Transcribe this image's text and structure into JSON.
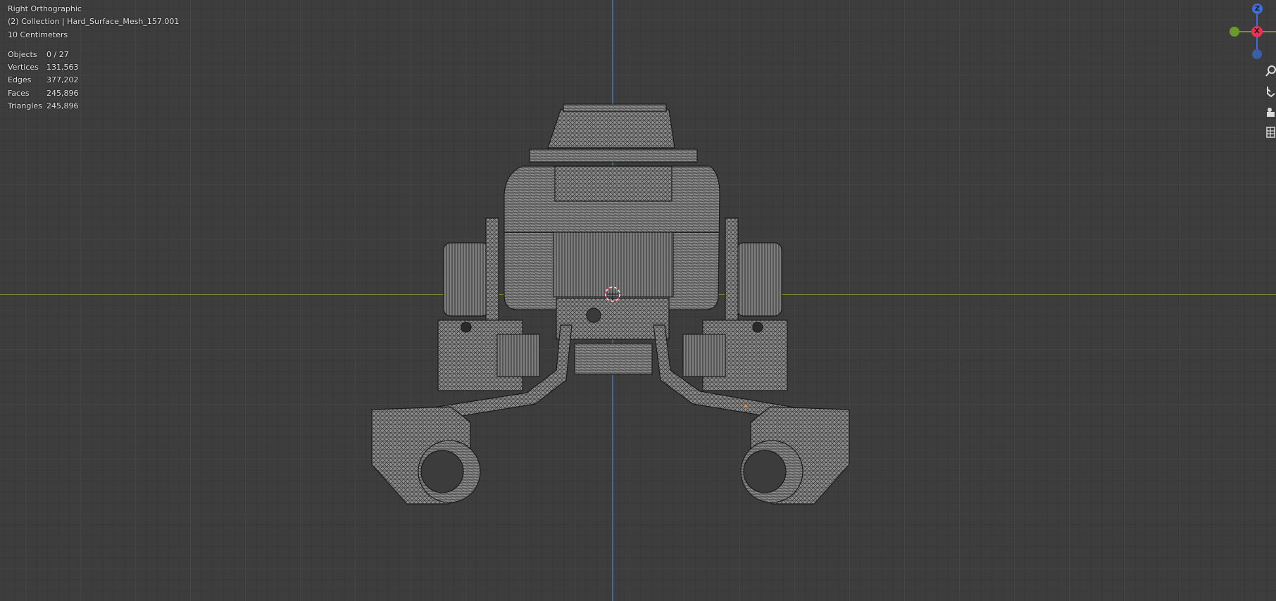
{
  "viewport": {
    "view_name": "Right Orthographic",
    "collection_line": "(2) Collection | Hard_Surface_Mesh_157.001",
    "scale": "10 Centimeters"
  },
  "stats": [
    {
      "label": "Objects",
      "value": "0 / 27"
    },
    {
      "label": "Vertices",
      "value": "131,563"
    },
    {
      "label": "Edges",
      "value": "377,202"
    },
    {
      "label": "Faces",
      "value": "245,896"
    },
    {
      "label": "Triangles",
      "value": "245,896"
    }
  ],
  "gizmo": {
    "z_label": "Z",
    "x_label": "X",
    "colors": {
      "z": "#3f6ed8",
      "x": "#e6334f",
      "y": "#6b9a2a"
    }
  },
  "nav_buttons": [
    {
      "icon": "zoom-icon"
    },
    {
      "icon": "pan-hand-icon"
    },
    {
      "icon": "camera-icon"
    },
    {
      "icon": "grid-icon"
    }
  ],
  "colors": {
    "background": "#3d3d3d",
    "x_axis_line": "#6f8a2e",
    "z_axis_line": "#3f6aa0",
    "mesh_fill": "#8a8a8a",
    "wire": "#1e1e1e"
  }
}
